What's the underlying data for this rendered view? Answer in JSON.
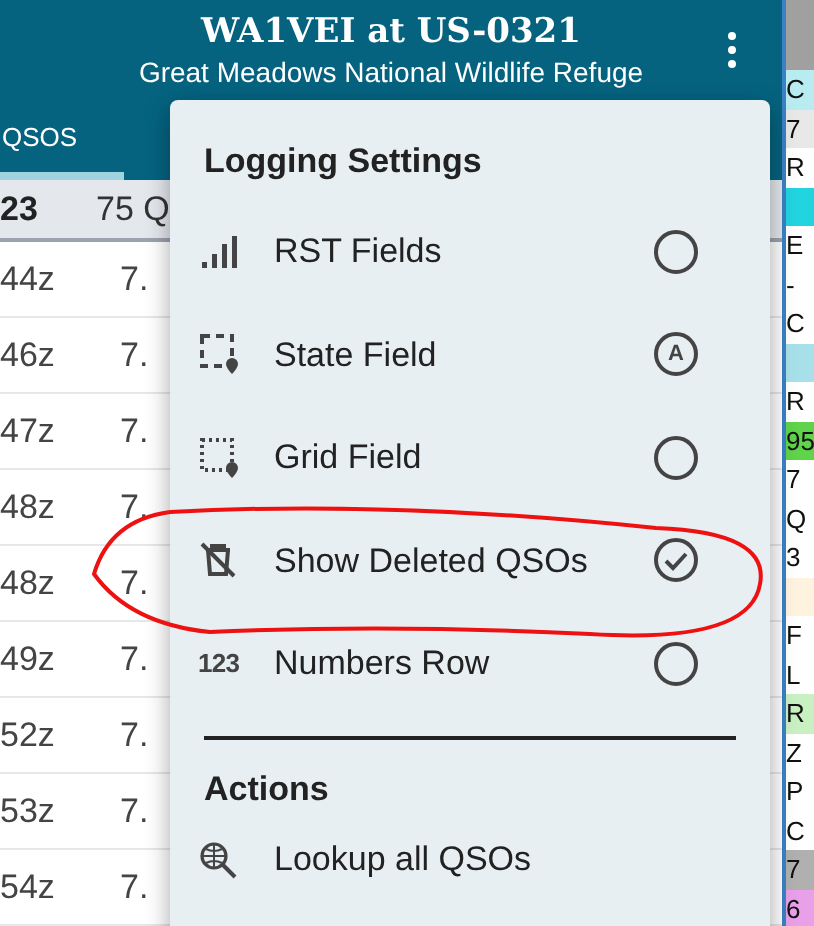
{
  "app_bar": {
    "title": "WA1VEI at US-0321",
    "subtitle": "Great Meadows National Wildlife Refuge"
  },
  "tabs": [
    {
      "label": "QSOS",
      "selected": true
    }
  ],
  "table": {
    "header": {
      "column_1": "23",
      "column_2": "75 Q"
    },
    "rows": [
      {
        "time": "44z",
        "freq": "7."
      },
      {
        "time": "46z",
        "freq": "7."
      },
      {
        "time": "47z",
        "freq": "7."
      },
      {
        "time": "48z",
        "freq": "7."
      },
      {
        "time": "48z",
        "freq": "7."
      },
      {
        "time": "49z",
        "freq": "7."
      },
      {
        "time": "52z",
        "freq": "7."
      },
      {
        "time": "53z",
        "freq": "7."
      },
      {
        "time": "54z",
        "freq": "7."
      }
    ]
  },
  "menu": {
    "settings_title": "Logging Settings",
    "settings": [
      {
        "kind": "signal",
        "label": "RST Fields",
        "checked": false
      },
      {
        "kind": "state",
        "label": "State Field",
        "checked": false,
        "badge": "A"
      },
      {
        "kind": "grid",
        "label": "Grid Field",
        "checked": false
      },
      {
        "kind": "deleted",
        "label": "Show Deleted QSOs",
        "checked": true
      },
      {
        "kind": "numbers",
        "label": "Numbers Row",
        "checked": false,
        "icon_text": "123"
      }
    ],
    "actions_title": "Actions",
    "actions": [
      {
        "kind": "lookup",
        "label": "Lookup all QSOs"
      }
    ]
  },
  "side_window": {
    "rows": [
      {
        "text": "C",
        "color": "#b8ecf0"
      },
      {
        "text": "7",
        "color": "#e8e8e8"
      },
      {
        "text": "R",
        "color": "#ffffff"
      },
      {
        "text": "",
        "color": "#22d3e0"
      },
      {
        "text": "E",
        "color": "#ffffff"
      },
      {
        "text": "-",
        "color": "#ffffff"
      },
      {
        "text": "C",
        "color": "#ffffff"
      },
      {
        "text": "",
        "color": "#a8e0ea"
      },
      {
        "text": "R",
        "color": "#ffffff"
      },
      {
        "text": "95",
        "color": "#5fd34a"
      },
      {
        "text": "7",
        "color": "#ffffff"
      },
      {
        "text": "Q",
        "color": "#ffffff"
      },
      {
        "text": "3",
        "color": "#ffffff"
      },
      {
        "text": "",
        "color": "#fff3e0"
      },
      {
        "text": "F",
        "color": "#ffffff"
      },
      {
        "text": "L",
        "color": "#ffffff"
      },
      {
        "text": "R",
        "color": "#c8f0c0"
      },
      {
        "text": "Z",
        "color": "#ffffff"
      },
      {
        "text": "P",
        "color": "#ffffff"
      },
      {
        "text": "C",
        "color": "#ffffff"
      },
      {
        "text": "7",
        "color": "#b0b0b0"
      },
      {
        "text": "6",
        "color": "#e8a0e8"
      }
    ]
  }
}
